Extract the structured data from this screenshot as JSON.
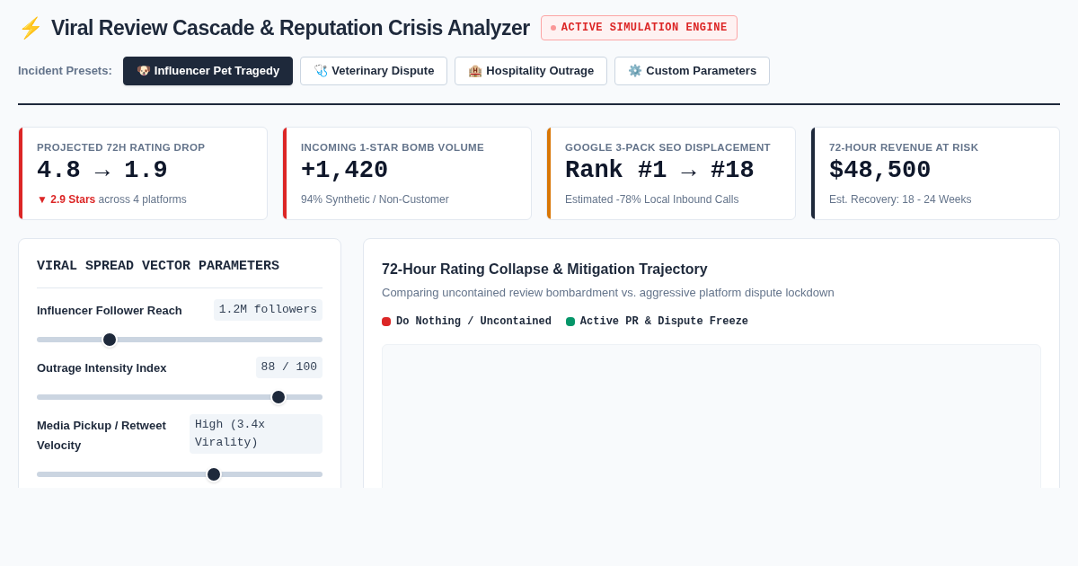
{
  "header": {
    "icon": "⚡",
    "title": "Viral Review Cascade & Reputation Crisis Analyzer",
    "badge": "ACTIVE SIMULATION ENGINE"
  },
  "presets": {
    "label": "Incident Presets:",
    "items": [
      {
        "icon": "🐶",
        "label": "Influencer Pet Tragedy",
        "selected": true
      },
      {
        "icon": "🩺",
        "label": "Veterinary Dispute",
        "selected": false
      },
      {
        "icon": "🏨",
        "label": "Hospitality Outrage",
        "selected": false
      },
      {
        "icon": "⚙️",
        "label": "Custom Parameters",
        "selected": false
      }
    ]
  },
  "metrics": [
    {
      "label": "PROJECTED 72H RATING DROP",
      "value": "4.8 → 1.9",
      "note_highlight": "▼ 2.9 Stars",
      "note": "across 4 platforms",
      "color": "#dc2626"
    },
    {
      "label": "INCOMING 1-STAR BOMB VOLUME",
      "value": "+1,420",
      "note": "94% Synthetic / Non-Customer",
      "color": "#dc2626"
    },
    {
      "label": "GOOGLE 3-PACK SEO DISPLACEMENT",
      "value": "Rank #1 → #18",
      "note": "Estimated -78% Local Inbound Calls",
      "color": "#d97706"
    },
    {
      "label": "72-HOUR REVENUE AT RISK",
      "value": "$48,500",
      "note": "Est. Recovery: 18 - 24 Weeks",
      "color": "#1e293b"
    }
  ],
  "parameters": {
    "title": "VIRAL SPREAD VECTOR PARAMETERS",
    "sliders": [
      {
        "label": "Influencer Follower Reach",
        "reading": "1.2M followers",
        "level": 0.255
      },
      {
        "label": "Outrage Intensity Index",
        "reading": "88 / 100",
        "level": 0.846
      },
      {
        "label": "Media Pickup / Retweet Velocity",
        "reading": "High (3.4x Virality)",
        "level": 0.62
      }
    ]
  },
  "trajectory": {
    "title": "72-Hour Rating Collapse & Mitigation Trajectory",
    "subtitle": "Comparing uncontained review bombardment vs. aggressive platform dispute lockdown",
    "legend": [
      {
        "label": "Do Nothing / Uncontained",
        "color": "#dc2626"
      },
      {
        "label": "Active PR & Dispute Freeze",
        "color": "#059669"
      }
    ]
  }
}
